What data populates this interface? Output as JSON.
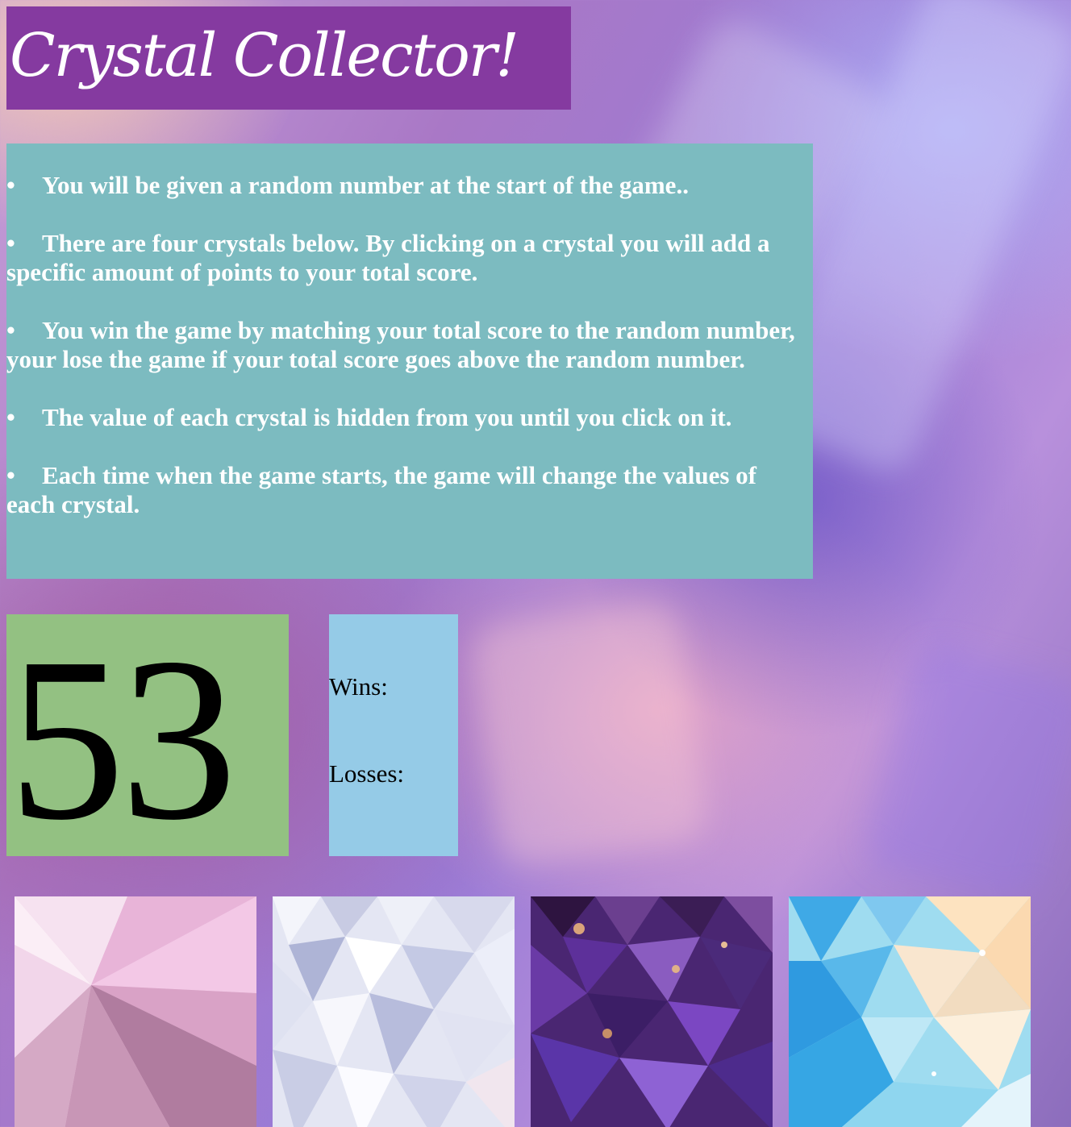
{
  "title": "Crystal Collector!",
  "rules": [
    "You will be given a random number at the start of the game..",
    "There are four crystals below. By clicking on a crystal you will add a specific amount of points to your total score.",
    "You win the game by matching your total score to the random number, your lose the game if your total score goes above the random number.",
    "The value of each crystal is hidden from you until you click on it.",
    "Each time when the game starts, the game will change the values of each crystal."
  ],
  "bullet_char": "•",
  "target_number": "53",
  "scoreboard": {
    "wins_label": "Wins:",
    "losses_label": "Losses:"
  },
  "crystals": [
    {
      "name": "pink-crystal",
      "color": "#d9a3c9"
    },
    {
      "name": "white-crystal",
      "color": "#d8dcf0"
    },
    {
      "name": "amethyst-crystal",
      "color": "#5a2f8a"
    },
    {
      "name": "blue-crystal",
      "color": "#5fc4ec"
    }
  ],
  "colors": {
    "title_bg": "#853aa0",
    "instructions_bg": "#7cbbc0",
    "target_bg": "#93c182",
    "score_bg": "#95cbe7"
  }
}
